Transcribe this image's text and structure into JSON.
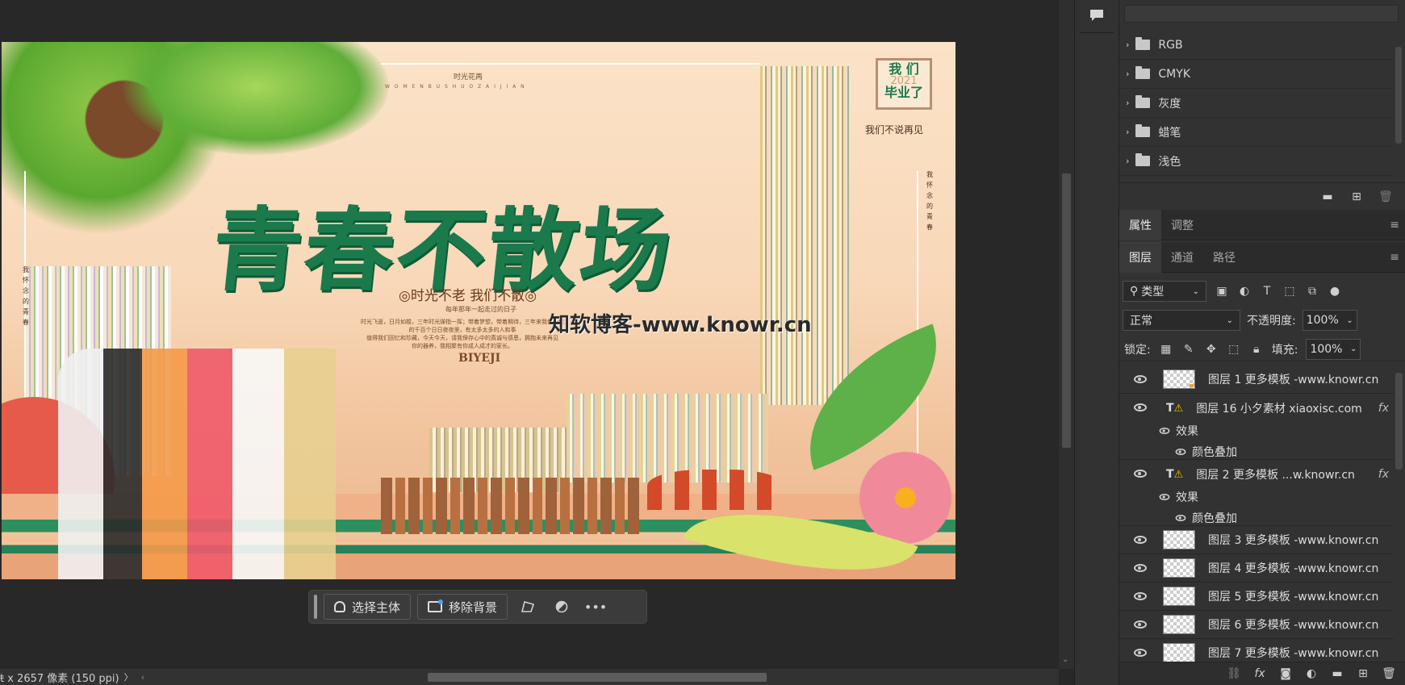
{
  "artwork": {
    "main_title": "青春不散场",
    "subtitle": "◎时光不老 我们不散◎",
    "small_heading": "时光花再",
    "pinyin_line": "W O M E N B U S H U O Z A I J I A N",
    "badge_line1": "我 们",
    "badge_year": "2021",
    "badge_line2": "毕业了",
    "right_tagline": "我们不说再见",
    "vertical_text_right": "我怀念的青春",
    "vertical_text_left": "我怀念的青春",
    "tag_line": "每年那年一起走过的日子",
    "body_lines": [
      "时光飞逝，日月如梭，三年时光弹指一挥；带着梦想，带着期待，三年来我们一起",
      "的千百个日日夜夜里，有太多太多的人和事",
      "值得我们回忆和珍藏，今天今天，请我保存心中的真诚与感恩，拥抱未来再见",
      "你的器养，我相聚有你成人成才的家长。"
    ],
    "biyeji": "BIYEJI",
    "watermark": "知软博客-www.knowr.cn"
  },
  "context_bar": {
    "select_subject": "选择主体",
    "remove_bg": "移除背景"
  },
  "status": {
    "doc_info": "ŧ x 2657 像素 (150 ppi)",
    "arrow": "〉"
  },
  "swatches": {
    "groups": [
      "RGB",
      "CMYK",
      "灰度",
      "蜡笔",
      "浅色"
    ]
  },
  "properties_tabs": [
    "属性",
    "调整"
  ],
  "layers_tabs": [
    "图层",
    "通道",
    "路径"
  ],
  "layers_panel": {
    "filter_kind": "类型",
    "blend_mode": "正常",
    "opacity_label": "不透明度:",
    "opacity_value": "100%",
    "lock_label": "锁定:",
    "fill_label": "填充:",
    "fill_value": "100%",
    "effects_label": "效果",
    "color_overlay": "颜色叠加",
    "layers": [
      {
        "name": "图层 1 更多模板 -www.knowr.cn"
      },
      {
        "name": "图层 16 小夕素材 xiaoxisc.com"
      },
      {
        "name": "图层 2 更多模板 ...w.knowr.cn"
      },
      {
        "name": "图层 3 更多模板 -www.knowr.cn"
      },
      {
        "name": "图层 4 更多模板 -www.knowr.cn"
      },
      {
        "name": "图层 5 更多模板 -www.knowr.cn"
      },
      {
        "name": "图层 6 更多模板 -www.knowr.cn"
      },
      {
        "name": "图层 7 更多模板 -www.knowr.cn"
      }
    ]
  },
  "colors": {
    "title_green": "#1a7a4c",
    "panel_bg": "#323232",
    "app_bg": "#282828"
  }
}
